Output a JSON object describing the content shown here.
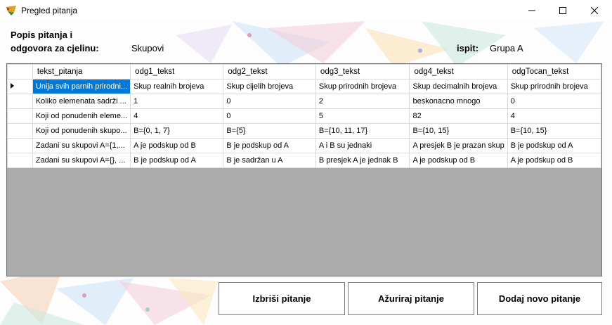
{
  "window": {
    "title": "Pregled pitanja"
  },
  "header": {
    "popis_label_line1": "Popis pitanja i",
    "popis_label_line2": "odgovora za cjelinu:",
    "cjelina_value": "Skupovi",
    "ispit_label": "ispit:",
    "ispit_value": "Grupa A"
  },
  "grid": {
    "columns": [
      "tekst_pitanja",
      "odg1_tekst",
      "odg2_tekst",
      "odg3_tekst",
      "odg4_tekst",
      "odgTocan_tekst"
    ],
    "rows": [
      [
        "Unija svih parnih prirodni...",
        "Skup realnih brojeva",
        "Skup cijelih brojeva",
        "Skup prirodnih brojeva",
        "Skup decimalnih brojeva",
        "Skup prirodnih brojeva"
      ],
      [
        "Koliko elemenata sadrži ...",
        "1",
        "0",
        "2",
        "beskonacno mnogo",
        "0"
      ],
      [
        "Koji od ponudenih eleme...",
        "4",
        "0",
        "5",
        "82",
        "4"
      ],
      [
        "Koji od ponudenih skupo...",
        "B={0, 1, 7}",
        "B={5}",
        "B={10, 11, 17}",
        "B={10, 15}",
        "B={10, 15}"
      ],
      [
        "Zadani su skupovi A={1,...",
        "A je podskup od B",
        "B je podskup od A",
        "A i B su jednaki",
        "A presjek B je prazan skup",
        "B je podskup od A"
      ],
      [
        "Zadani su skupovi A={}, ...",
        "B je podskup od A",
        "B je sadržan u A",
        "B presjek A je jednak B",
        "A je podskup od B",
        "A je podskup od B"
      ]
    ],
    "selected_row": 0
  },
  "buttons": {
    "delete": "Izbriši pitanje",
    "update": "Ažuriraj pitanje",
    "add": "Dodaj novo pitanje"
  },
  "colors": {
    "selection": "#0078d7",
    "grid_empty": "#ababab"
  }
}
